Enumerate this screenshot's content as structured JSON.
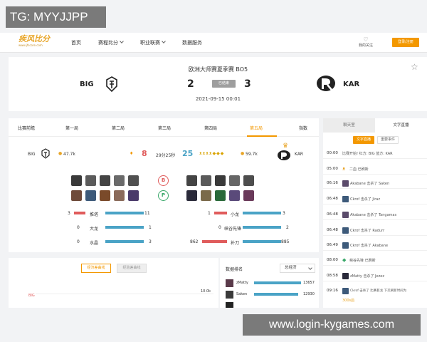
{
  "watermark_top": "TG: MYYJJPP",
  "watermark_bottom": "www.login-kygames.com",
  "nav": {
    "logo_title": "疾风比分",
    "logo_sub": "www.jfscore.com",
    "items": [
      {
        "label": "首页"
      },
      {
        "label": "赛程比分"
      },
      {
        "label": "职业联赛"
      },
      {
        "label": "数据服务"
      }
    ],
    "favorites": "我的关注",
    "login": "登录/注册"
  },
  "match": {
    "title": "欧洲大师赛夏季赛 BO5",
    "team_left": "BIG",
    "team_right": "KAR",
    "score_left": "2",
    "score_right": "3",
    "status": "已结束",
    "date": "2021-09-15 00:01"
  },
  "tabs": [
    {
      "label": "比赛前瞻"
    },
    {
      "label": "第一局"
    },
    {
      "label": "第二局"
    },
    {
      "label": "第三局"
    },
    {
      "label": "第四局"
    },
    {
      "label": "第五局"
    },
    {
      "label": "指数"
    }
  ],
  "game": {
    "left_team": "BIG",
    "left_gold": "47.7k",
    "left_kills": "8",
    "duration": "29分25秒",
    "right_kills": "25",
    "right_gold": "59.7k",
    "right_team": "KAR",
    "ban_left": "B",
    "ban_right": "P"
  },
  "objectives": {
    "left": [
      {
        "count": "3",
        "label": "推塔",
        "value": "11"
      },
      {
        "count": "0",
        "label": "大龙",
        "value": "1"
      },
      {
        "count": "0",
        "label": "水晶",
        "value": "3"
      }
    ],
    "right": [
      {
        "count": "1",
        "label": "小龙",
        "value": "3"
      },
      {
        "count": "0",
        "label": "峡谷先锋",
        "value": "2"
      },
      {
        "count": "862",
        "label": "补刀",
        "value": "885"
      }
    ]
  },
  "lower": {
    "btn_active": "经济差曲线",
    "btn_inactive": "经验差曲线",
    "y_label": "10.0k",
    "team_label": "BIG",
    "rank_title": "数据排名",
    "rank_select": "总经济",
    "ranks": [
      {
        "name": "zMatty",
        "value": "13657"
      },
      {
        "name": "Saken",
        "value": "12930"
      }
    ]
  },
  "sidebar": {
    "tab_chat": "聊天室",
    "tab_live": "文字直播",
    "pill_live": "文字直播",
    "pill_event": "重要事件",
    "events": [
      {
        "time": "00:00",
        "desc": "比赛开始! 红方: BIG 蓝方: KAR"
      },
      {
        "time": "05:00",
        "desc": "二血 已刷新"
      },
      {
        "time": "06:16",
        "desc": "Akabane 击杀了 Saken"
      },
      {
        "time": "06:48",
        "desc": "Ckrof 击杀了 Jiraz"
      },
      {
        "time": "06:48",
        "desc": "Akabane 击杀了 Tangamas"
      },
      {
        "time": "06:48",
        "desc": "Ckrof 击杀了 Radurr"
      },
      {
        "time": "06:49",
        "desc": "Ckrof 击杀了 Akabane"
      },
      {
        "time": "08:00",
        "desc": "峡谷先锋 已刷新"
      },
      {
        "time": "08:58",
        "desc": "zMatty 击杀了 Jezez"
      },
      {
        "time": "09:16",
        "desc": "Ckrof 击杀了 比赛巨龙 下次刷新时间为"
      },
      {
        "time": "",
        "desc": "300s后"
      }
    ]
  },
  "colors": {
    "accent": "#f39800",
    "red": "#e05c5c",
    "blue": "#4aa3c6"
  }
}
